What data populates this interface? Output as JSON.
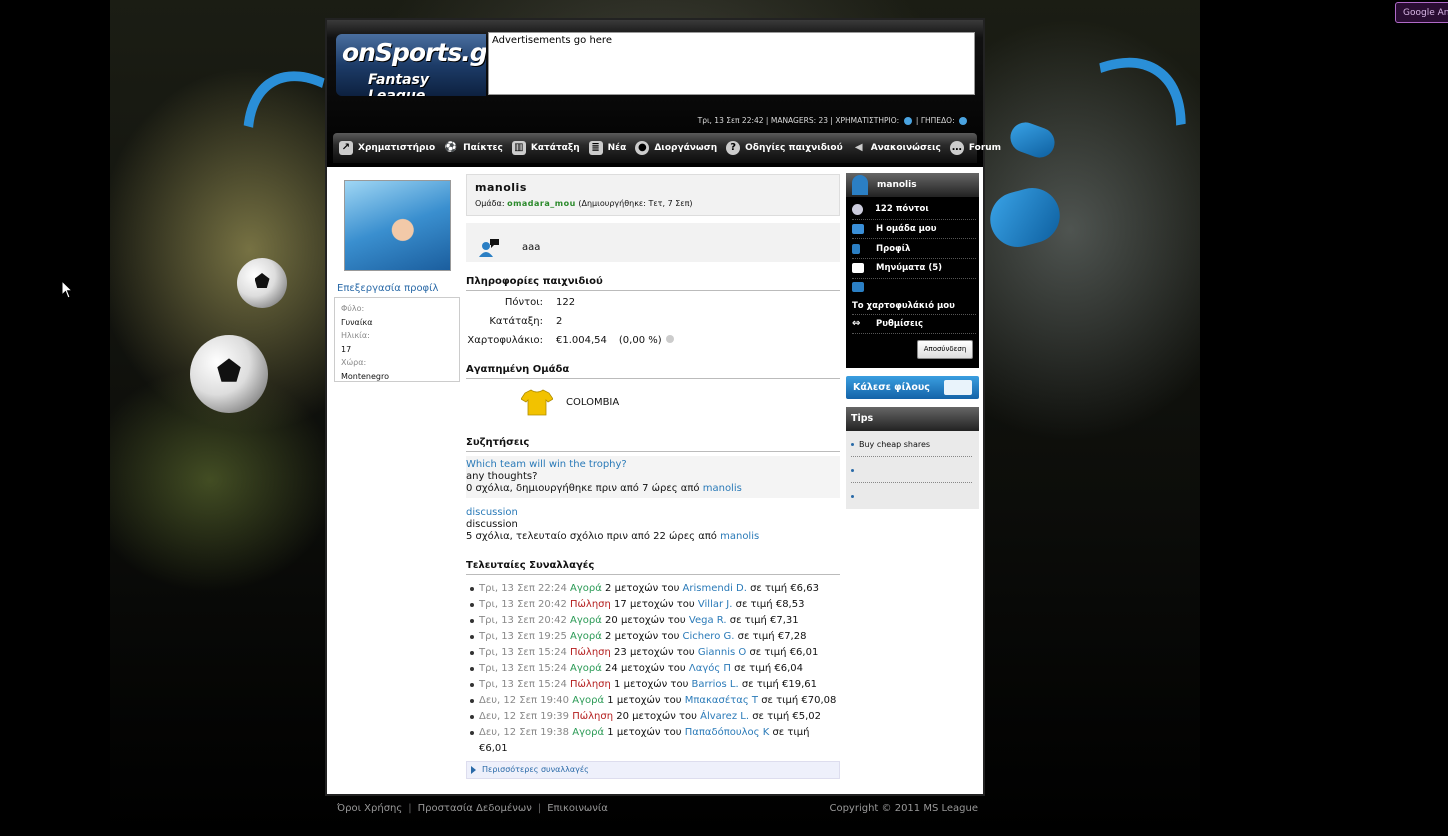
{
  "browser": {
    "google_button": "Google An"
  },
  "header": {
    "logo_line1": "onSports.gr",
    "logo_line2": "Fantasy League",
    "ad_text": "Advertisements go here",
    "topbar": {
      "datetime": "Τρι, 13 Σεπ 22:42",
      "managers": "MANAGERS: 23",
      "exchange": "ΧΡΗΜΑΤΙΣΤΗΡΙΟ:",
      "field": "ΓΗΠΕΔΟ:"
    }
  },
  "nav": {
    "items": [
      {
        "label": "Χρηματιστήριο"
      },
      {
        "label": "Παίκτες"
      },
      {
        "label": "Κατάταξη"
      },
      {
        "label": "Νέα"
      },
      {
        "label": "Διοργάνωση"
      },
      {
        "label": "Οδηγίες παιχνιδιού"
      },
      {
        "label": "Ανακοινώσεις"
      },
      {
        "label": "Forum"
      }
    ]
  },
  "left": {
    "edit_profile": "Επεξεργασία προφίλ",
    "gender_label": "Φύλο:",
    "gender": "Γυναίκα",
    "age_label": "Ηλικία:",
    "age": "17",
    "country_label": "Χώρα:",
    "country": "Montenegro"
  },
  "profile": {
    "username": "manolis",
    "team_label": "Ομάδα:",
    "team": "omadara_mou",
    "created": "(Δημιουργήθηκε: Τετ, 7 Σεπ)",
    "status": "aaa"
  },
  "game_info": {
    "title": "Πληροφορίες παιχνιδιού",
    "points_label": "Πόντοι:",
    "points": "122",
    "rank_label": "Κατάταξη:",
    "rank": "2",
    "portfolio_label": "Χαρτοφυλάκιο:",
    "portfolio": "€1.004,54",
    "portfolio_change": "(0,00 %)"
  },
  "favorite": {
    "title": "Αγαπημένη Ομάδα",
    "team": "COLOMBIA",
    "shirt_color": "#f2c200"
  },
  "discussions": {
    "title": "Συζητήσεις",
    "threads": [
      {
        "title": "Which team will win the trophy?",
        "body": "any thoughts?",
        "meta": "0 σχόλια, δημιουργήθηκε πριν από 7 ώρες από",
        "user": "manolis"
      },
      {
        "title": "discussion",
        "body": "discussion",
        "meta": "5 σχόλια, τελευταίο σχόλιο πριν από 22 ώρες από",
        "user": "manolis"
      }
    ]
  },
  "trades": {
    "title": "Τελευταίες Συναλλαγές",
    "mid1": "μετοχών του",
    "mid2": "σε τιμή",
    "items": [
      {
        "date": "Τρι, 13 Σεπ 22:24",
        "action": "Αγορά",
        "type": "buy",
        "qty": "2",
        "player": "Arismendi D.",
        "price": "€6,63"
      },
      {
        "date": "Τρι, 13 Σεπ 20:42",
        "action": "Πώληση",
        "type": "sell",
        "qty": "17",
        "player": "Villar J.",
        "price": "€8,53"
      },
      {
        "date": "Τρι, 13 Σεπ 20:42",
        "action": "Αγορά",
        "type": "buy",
        "qty": "20",
        "player": "Vega R.",
        "price": "€7,31"
      },
      {
        "date": "Τρι, 13 Σεπ 19:25",
        "action": "Αγορά",
        "type": "buy",
        "qty": "2",
        "player": "Cichero G.",
        "price": "€7,28"
      },
      {
        "date": "Τρι, 13 Σεπ 15:24",
        "action": "Πώληση",
        "type": "sell",
        "qty": "23",
        "player": "Giannis O",
        "price": "€6,01"
      },
      {
        "date": "Τρι, 13 Σεπ 15:24",
        "action": "Αγορά",
        "type": "buy",
        "qty": "24",
        "player": "Λαγός Π",
        "price": "€6,04"
      },
      {
        "date": "Τρι, 13 Σεπ 15:24",
        "action": "Πώληση",
        "type": "sell",
        "qty": "1",
        "player": "Barrios L.",
        "price": "€19,61"
      },
      {
        "date": "Δευ, 12 Σεπ 19:40",
        "action": "Αγορά",
        "type": "buy",
        "qty": "1",
        "player": "Μπακασέτας Τ",
        "price": "€70,08"
      },
      {
        "date": "Δευ, 12 Σεπ 19:39",
        "action": "Πώληση",
        "type": "sell",
        "qty": "20",
        "player": "Álvarez L.",
        "price": "€5,02"
      },
      {
        "date": "Δευ, 12 Σεπ 19:38",
        "action": "Αγορά",
        "type": "buy",
        "qty": "1",
        "player": "Παπαδόπουλος Κ",
        "price": "€6,01"
      }
    ],
    "more": "Περισσότερες συναλλαγές"
  },
  "user_panel": {
    "username": "manolis",
    "points": "122 πόντοι",
    "my_team": "Η ομάδα μου",
    "profile": "Προφίλ",
    "messages": "Μηνύματα (5)",
    "portfolio": "Το χαρτοφυλάκιό μου",
    "settings": "Ρυθμίσεις",
    "logout": "Αποσύνδεση"
  },
  "invite": {
    "label": "Κάλεσε φίλους"
  },
  "tips": {
    "title": "Tips",
    "items": [
      "Buy cheap shares",
      "",
      ""
    ]
  },
  "footer": {
    "terms": "Όροι Χρήσης",
    "privacy": "Προστασία Δεδομένων",
    "contact": "Επικοινωνία",
    "copyright": "Copyright © 2011 MS League"
  }
}
